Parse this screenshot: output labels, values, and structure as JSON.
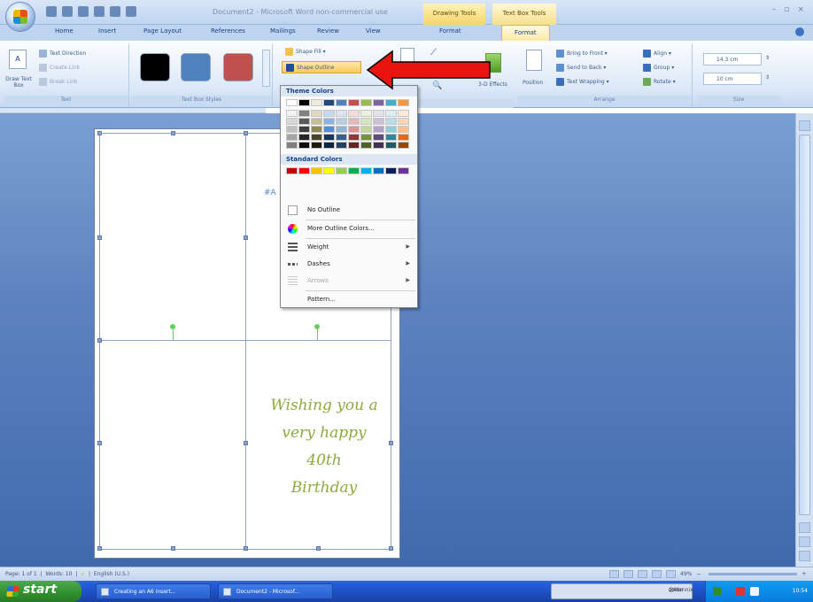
{
  "window": {
    "title": "Document2 - Microsoft Word non-commercial use",
    "contextual_tab_1": "Drawing Tools",
    "contextual_tab_2": "Text Box Tools"
  },
  "tabs": [
    {
      "label": "Home"
    },
    {
      "label": "Insert"
    },
    {
      "label": "Page Layout"
    },
    {
      "label": "References"
    },
    {
      "label": "Mailings"
    },
    {
      "label": "Review"
    },
    {
      "label": "View"
    },
    {
      "label": "Format"
    },
    {
      "label": "Format"
    }
  ],
  "ribbon": {
    "text_group": {
      "label": "Text",
      "draw_text_box": "Draw Text Box",
      "text_direction": "Text Direction",
      "create_link": "Create Link",
      "break_link": "Break Link"
    },
    "styles_group": {
      "label": "Text Box Styles",
      "swatches": [
        "#000000",
        "#4f81bd",
        "#c0504d"
      ]
    },
    "shape_fill": "Shape Fill",
    "shape_outline": "Shape Outline",
    "effects_label": "3-D Effects",
    "arrange_group": {
      "label": "Arrange",
      "position": "Position",
      "bring_to_front": "Bring to Front",
      "send_to_back": "Send to Back",
      "text_wrapping": "Text Wrapping",
      "align": "Align",
      "group": "Group",
      "rotate": "Rotate"
    },
    "size_group": {
      "label": "Size",
      "height": "14.3 cm",
      "width": "10 cm"
    }
  },
  "menu": {
    "theme_header": "Theme Colors",
    "standard_header": "Standard Colors",
    "theme_top_row": [
      "#ffffff",
      "#000000",
      "#eeece1",
      "#1f497d",
      "#4f81bd",
      "#c0504d",
      "#9bbb59",
      "#8064a2",
      "#4bacc6",
      "#f79646"
    ],
    "theme_shades": [
      [
        "#f2f2f2",
        "#7f7f7f",
        "#ddd9c3",
        "#c6d9f0",
        "#dbe5f1",
        "#f2dcdb",
        "#ebf1dd",
        "#e5e0ec",
        "#dbeef3",
        "#fdeada"
      ],
      [
        "#d8d8d8",
        "#595959",
        "#c4bd97",
        "#8db3e2",
        "#b8cce4",
        "#e5b9b7",
        "#d7e3bc",
        "#ccc1d9",
        "#b7dde8",
        "#fbd5b5"
      ],
      [
        "#bfbfbf",
        "#3f3f3f",
        "#938953",
        "#548dd4",
        "#95b3d7",
        "#d99694",
        "#c3d69b",
        "#b2a2c7",
        "#92cddc",
        "#fac08f"
      ],
      [
        "#a5a5a5",
        "#262626",
        "#494429",
        "#17365d",
        "#366092",
        "#953734",
        "#76923c",
        "#5f497a",
        "#31859b",
        "#e36c09"
      ],
      [
        "#7f7f7f",
        "#0c0c0c",
        "#1d1b10",
        "#0f243e",
        "#244061",
        "#632423",
        "#4f6128",
        "#3f3151",
        "#205867",
        "#974806"
      ]
    ],
    "standard_colors": [
      "#c00000",
      "#ff0000",
      "#ffc000",
      "#ffff00",
      "#92d050",
      "#00b050",
      "#00b0f0",
      "#0070c0",
      "#002060",
      "#7030a0"
    ],
    "items": [
      {
        "label": "No Outline",
        "has_submenu": false,
        "disabled": false,
        "icon": "no-outline-icon"
      },
      {
        "label": "More Outline Colors...",
        "has_submenu": false,
        "disabled": false,
        "icon": "color-wheel-icon"
      },
      {
        "label": "Weight",
        "has_submenu": true,
        "disabled": false,
        "icon": "line-weight-icon"
      },
      {
        "label": "Dashes",
        "has_submenu": true,
        "disabled": false,
        "icon": "dashes-icon"
      },
      {
        "label": "Arrows",
        "has_submenu": true,
        "disabled": true,
        "icon": "arrows-icon"
      },
      {
        "label": "Pattern...",
        "has_submenu": false,
        "disabled": false,
        "icon": ""
      }
    ]
  },
  "document": {
    "greeting_lines": [
      "Wishing you a",
      "very happy 40th",
      "Birthday"
    ],
    "partial_text": "#A"
  },
  "statusbar": {
    "page": "Page: 1 of 1",
    "words": "Words: 10",
    "language": "English (U.S.)",
    "zoom": "49%"
  },
  "taskbar": {
    "start": "start",
    "task1": "Creating an A6 insert...",
    "task2": "Document2 - Microsof...",
    "tray_app_line1": "zoom",
    "tray_app_line2": "@Mannix",
    "clock": "10:54"
  },
  "colors": {
    "accent_red": "#e8150f",
    "ribbon_blue": "#15428b",
    "greeting_green": "#8bab3c"
  }
}
